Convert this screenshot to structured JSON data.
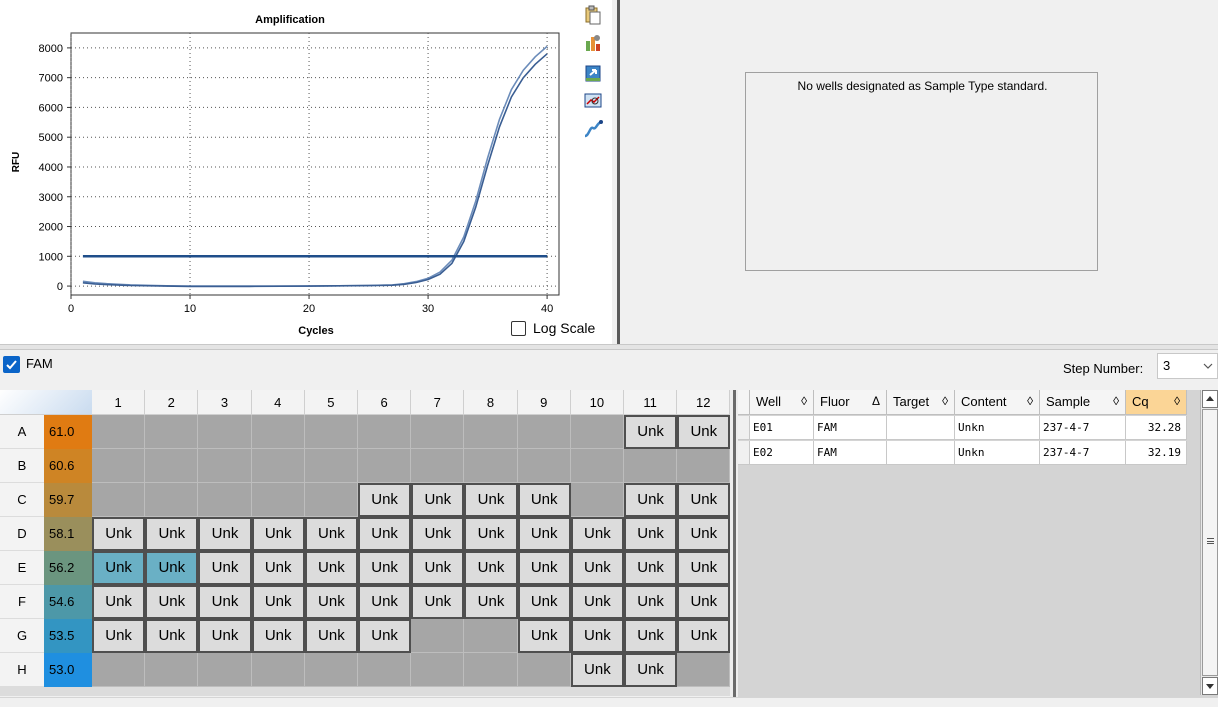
{
  "chart_data": {
    "type": "line",
    "title": "Amplification",
    "xlabel": "Cycles",
    "ylabel": "RFU",
    "xlim": [
      0,
      41
    ],
    "ylim": [
      -300,
      8500
    ],
    "xticks": [
      0,
      10,
      20,
      30,
      40
    ],
    "yticks": [
      0,
      1000,
      2000,
      3000,
      4000,
      5000,
      6000,
      7000,
      8000
    ],
    "grid": "dotted",
    "threshold": 1000,
    "series": [
      {
        "x": [
          1,
          2,
          3,
          5,
          8,
          10,
          15,
          20,
          25,
          27,
          28,
          29,
          30,
          31,
          32,
          33,
          34,
          35,
          36,
          37,
          38,
          39,
          40
        ],
        "y": [
          160,
          110,
          80,
          40,
          10,
          0,
          0,
          0,
          20,
          40,
          80,
          150,
          260,
          470,
          870,
          1650,
          2850,
          4300,
          5600,
          6600,
          7250,
          7700,
          8050
        ]
      },
      {
        "x": [
          1,
          2,
          3,
          5,
          8,
          10,
          15,
          20,
          25,
          27,
          28,
          29,
          30,
          31,
          32,
          33,
          34,
          35,
          36,
          37,
          38,
          39,
          40
        ],
        "y": [
          110,
          70,
          50,
          20,
          0,
          -10,
          -10,
          0,
          15,
          30,
          60,
          120,
          220,
          400,
          760,
          1500,
          2650,
          4050,
          5350,
          6350,
          7000,
          7450,
          7800
        ]
      }
    ],
    "colors": [
      "#6b8cba",
      "#3a5e93"
    ],
    "threshold_color": "#1f4e8a"
  },
  "chart_tools": [
    "copy-icon",
    "chart-settings-icon",
    "export-icon",
    "zoom-icon",
    "curve-icon"
  ],
  "log_scale": {
    "label": "Log Scale",
    "checked": false
  },
  "standard_curve": {
    "message": "No wells designated as Sample Type standard."
  },
  "fluor": {
    "label": "FAM",
    "checked": true
  },
  "step": {
    "label": "Step Number:",
    "value": "3"
  },
  "plate": {
    "columns": [
      "1",
      "2",
      "3",
      "4",
      "5",
      "6",
      "7",
      "8",
      "9",
      "10",
      "11",
      "12"
    ],
    "rows": [
      {
        "letter": "A",
        "temp": "61.0",
        "temp_color": "#e07b12",
        "wells": [
          "",
          "",
          "",
          "",
          "",
          "",
          "",
          "",
          "",
          "",
          "Unk",
          "Unk"
        ]
      },
      {
        "letter": "B",
        "temp": "60.6",
        "temp_color": "#cf8424",
        "wells": [
          "",
          "",
          "",
          "",
          "",
          "",
          "",
          "",
          "",
          "",
          "",
          ""
        ]
      },
      {
        "letter": "C",
        "temp": "59.7",
        "temp_color": "#b98a3c",
        "wells": [
          "",
          "",
          "",
          "",
          "",
          "Unk",
          "Unk",
          "Unk",
          "Unk",
          "",
          "Unk",
          "Unk"
        ]
      },
      {
        "letter": "D",
        "temp": "58.1",
        "temp_color": "#9a8f5c",
        "wells": [
          "Unk",
          "Unk",
          "Unk",
          "Unk",
          "Unk",
          "Unk",
          "Unk",
          "Unk",
          "Unk",
          "Unk",
          "Unk",
          "Unk"
        ]
      },
      {
        "letter": "E",
        "temp": "56.2",
        "temp_color": "#6b957f",
        "wells": [
          "Unk",
          "Unk",
          "Unk",
          "Unk",
          "Unk",
          "Unk",
          "Unk",
          "Unk",
          "Unk",
          "Unk",
          "Unk",
          "Unk"
        ],
        "selected": [
          0,
          1
        ]
      },
      {
        "letter": "F",
        "temp": "54.6",
        "temp_color": "#4d98a8",
        "wells": [
          "Unk",
          "Unk",
          "Unk",
          "Unk",
          "Unk",
          "Unk",
          "Unk",
          "Unk",
          "Unk",
          "Unk",
          "Unk",
          "Unk"
        ]
      },
      {
        "letter": "G",
        "temp": "53.5",
        "temp_color": "#3395c2",
        "wells": [
          "Unk",
          "Unk",
          "Unk",
          "Unk",
          "Unk",
          "Unk",
          "",
          "",
          "Unk",
          "Unk",
          "Unk",
          "Unk"
        ]
      },
      {
        "letter": "H",
        "temp": "53.0",
        "temp_color": "#1f8fe0",
        "wells": [
          "",
          "",
          "",
          "",
          "",
          "",
          "",
          "",
          "",
          "Unk",
          "Unk",
          ""
        ]
      }
    ]
  },
  "table": {
    "columns": [
      {
        "label": "Well",
        "sort": "◊"
      },
      {
        "label": "Fluor",
        "sort": "Δ"
      },
      {
        "label": "Target",
        "sort": "◊"
      },
      {
        "label": "Content",
        "sort": "◊"
      },
      {
        "label": "Sample",
        "sort": "◊"
      },
      {
        "label": "Cq",
        "sort": "◊"
      }
    ],
    "rows": [
      [
        "E01",
        "FAM",
        "",
        "Unkn",
        "237-4-7",
        "32.28"
      ],
      [
        "E02",
        "FAM",
        "",
        "Unkn",
        "237-4-7",
        "32.19"
      ]
    ]
  }
}
